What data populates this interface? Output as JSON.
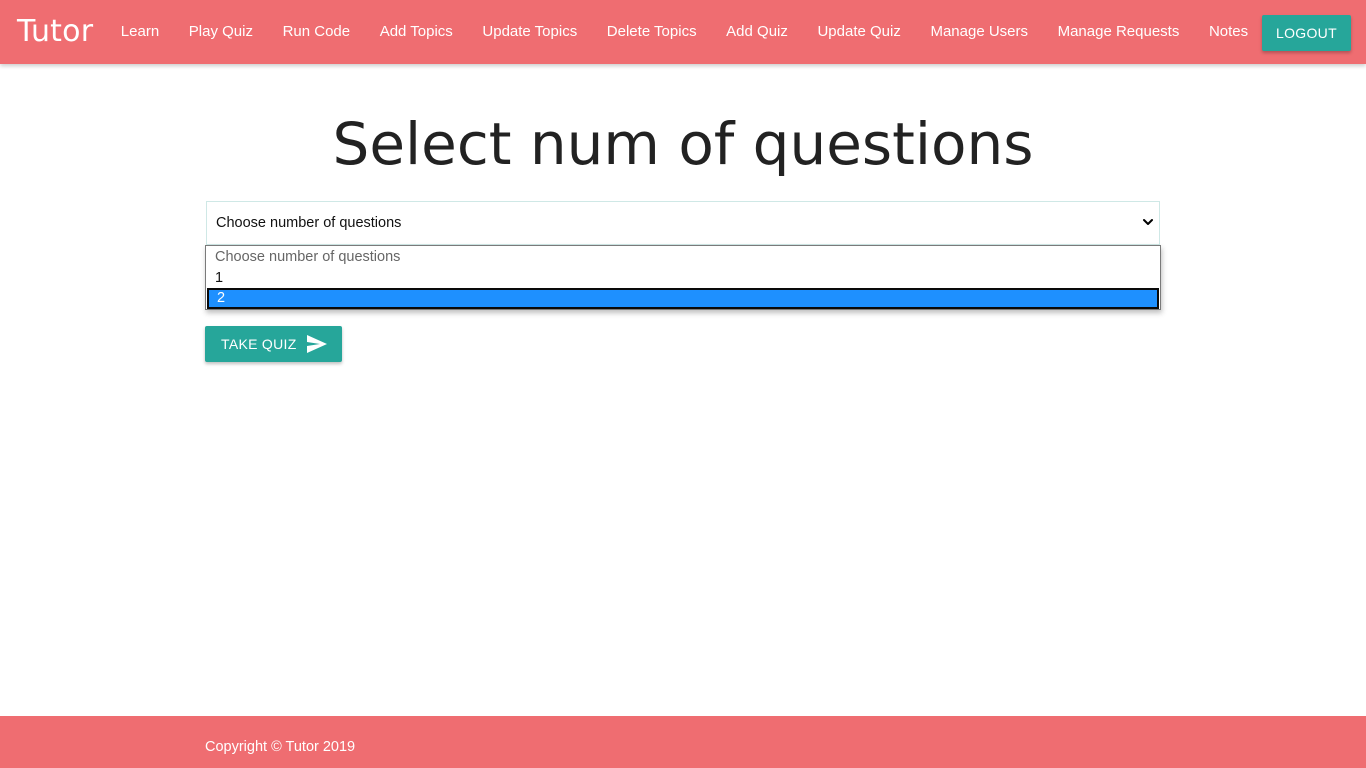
{
  "nav": {
    "brand": "Tutor",
    "links": [
      "Learn",
      "Play Quiz",
      "Run Code",
      "Add Topics",
      "Update Topics",
      "Delete Topics",
      "Add Quiz",
      "Update Quiz",
      "Manage Users",
      "Manage Requests",
      "Notes"
    ],
    "logout_label": "LOGOUT"
  },
  "main": {
    "heading": "Select num of questions",
    "select": {
      "value": "Choose number of questions",
      "options": [
        "Choose number of questions",
        "1",
        "2"
      ],
      "highlighted_option": "2"
    },
    "submit_label": "TAKE QUIZ",
    "submit_icon": "send-icon"
  },
  "footer": {
    "copyright": "Copyright © Tutor 2019"
  },
  "colors": {
    "brand": "#ef6d71",
    "accent": "#26a69a",
    "highlight": "#1e90ff"
  }
}
